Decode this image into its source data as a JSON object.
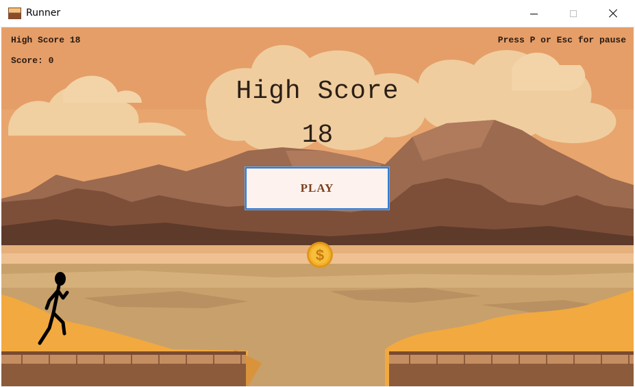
{
  "window": {
    "title": "Runner",
    "icon": "desert-landscape-icon",
    "controls": [
      "minimize-icon",
      "maximize-icon",
      "close-icon"
    ]
  },
  "hud": {
    "high_score_text": "High Score 18",
    "score_text": "Score: 0",
    "pause_hint": "Press P or Esc for pause"
  },
  "menu": {
    "heading": "High Score",
    "value": "18",
    "play_label": "PLAY"
  },
  "sprites": {
    "coin_symbol": "$",
    "player": "stick-figure-runner"
  },
  "colors": {
    "sky": "#e9a56e",
    "cloud": "#f0cfa0",
    "mountain": "#8a5a42",
    "desert": "#c9a26d",
    "sand": "#f2a93f",
    "ground": "#a56f4a",
    "button_border": "#2f7bd2",
    "button_fill": "#fdf2ee",
    "coin": "#f0a81f"
  }
}
